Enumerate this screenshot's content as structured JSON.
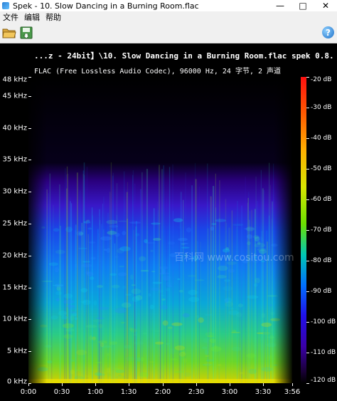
{
  "window": {
    "title": "Spek - 10. Slow Dancing in a Burning Room.flac",
    "minimize_glyph": "—",
    "maximize_glyph": "□",
    "close_glyph": "✕"
  },
  "menu": [
    "文件",
    "编辑",
    "帮助"
  ],
  "toolbar": {
    "open_icon": "folder-open-icon",
    "save_icon": "save-icon",
    "help_icon": "help-icon",
    "help_glyph": "?"
  },
  "header": {
    "file_line": "...z  -  24bit】\\10. Slow Dancing in a Burning Room.flac  spek 0.8.",
    "codec_line": "FLAC (Free Lossless Audio Codec), 96000 Hz, 24 字节, 2 声道"
  },
  "watermark": "百科网 www.cositou.com",
  "chart_data": {
    "type": "heatmap",
    "title": "",
    "xlabel": "",
    "ylabel": "",
    "y_ticks": [
      "0 kHz",
      "5 kHz",
      "10 kHz",
      "15 kHz",
      "20 kHz",
      "25 kHz",
      "30 kHz",
      "35 kHz",
      "40 kHz",
      "45 kHz",
      "48 kHz"
    ],
    "y_values_khz": [
      0,
      5,
      10,
      15,
      20,
      25,
      30,
      35,
      40,
      45,
      48
    ],
    "ylim_khz": [
      0,
      48
    ],
    "x_ticks": [
      "0:00",
      "0:30",
      "1:00",
      "1:30",
      "2:00",
      "2:30",
      "3:00",
      "3:30",
      "3:56"
    ],
    "x_values_s": [
      0,
      30,
      60,
      90,
      120,
      150,
      180,
      210,
      236
    ],
    "xlim_s": [
      0,
      236
    ],
    "colorbar_ticks": [
      "-20 dB",
      "-30 dB",
      "-40 dB",
      "-50 dB",
      "-60 dB",
      "-70 dB",
      "-80 dB",
      "-90 dB",
      "-100 dB",
      "-110 dB",
      "-120 dB"
    ],
    "colorbar_values_db": [
      -20,
      -30,
      -40,
      -50,
      -60,
      -70,
      -80,
      -90,
      -100,
      -110,
      -120
    ],
    "colorbar_range_db": [
      -120,
      -20
    ],
    "colors": [
      "#ff1010",
      "#ffb000",
      "#6be000",
      "#00c8b4",
      "#0070ff",
      "#3a00a8",
      "#000000"
    ]
  }
}
